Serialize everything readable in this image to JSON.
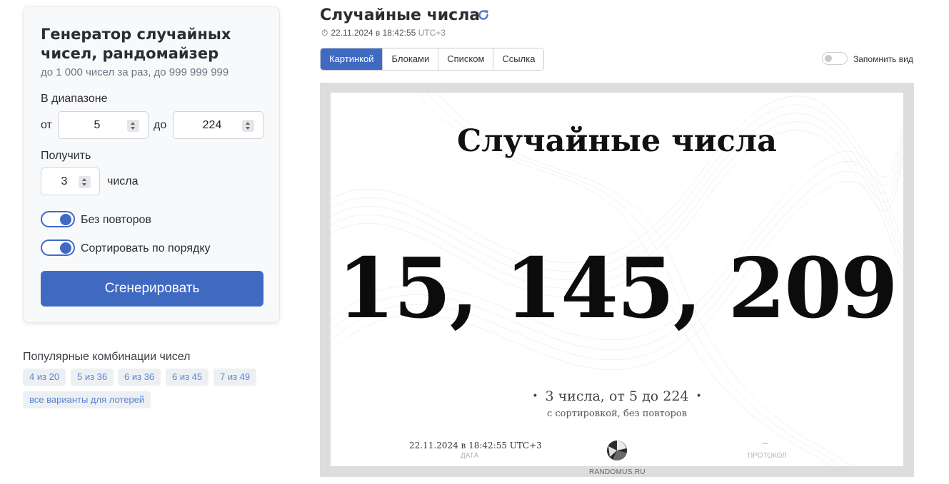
{
  "generator": {
    "title": "Генератор случайных чисел, рандомайзер",
    "subtitle": "до 1 000 чисел за раз, до 999 999 999",
    "range_label": "В диапазоне",
    "from_label": "от",
    "from_value": "5",
    "to_label": "до",
    "to_value": "224",
    "get_label": "Получить",
    "count_value": "3",
    "count_unit": "числа",
    "no_repeat_label": "Без повторов",
    "no_repeat_on": true,
    "sort_label": "Сортировать по порядку",
    "sort_on": true,
    "generate_button": "Сгенерировать"
  },
  "popular": {
    "title": "Популярные комбинации чисел",
    "chips": [
      "4 из 20",
      "5 из 36",
      "6 из 36",
      "6 из 45",
      "7 из 49"
    ],
    "all_lotteries": "все варианты для лотерей"
  },
  "header": {
    "title": "Случайные числа",
    "timestamp": "22.11.2024 в 18:42:55",
    "timezone": "UTC+3"
  },
  "view_tabs": {
    "items": [
      "Картинкой",
      "Блоками",
      "Списком",
      "Ссылка"
    ],
    "active": "Картинкой"
  },
  "remember_view": {
    "label": "Запомнить вид",
    "on": false
  },
  "result": {
    "title": "Случайные числа",
    "numbers": "15, 145, 209",
    "description": "3 числа, от 5 до 224",
    "subdescription": "с сортировкой, без повторов",
    "date": "22.11.2024 в 18:42:55 UTC+3",
    "date_caption": "ДАТА",
    "protocol_value": "–",
    "protocol_caption": "ПРОТОКОЛ",
    "brand": "RANDOMUS.RU"
  },
  "colors": {
    "accent": "#4069c2",
    "chip_text": "#5b84cf",
    "chip_bg": "#edf0f3",
    "frame": "#dddddd"
  },
  "icons": {
    "refresh": "refresh-icon",
    "timer": "stopwatch-icon",
    "logo": "randomus-logo-icon"
  }
}
